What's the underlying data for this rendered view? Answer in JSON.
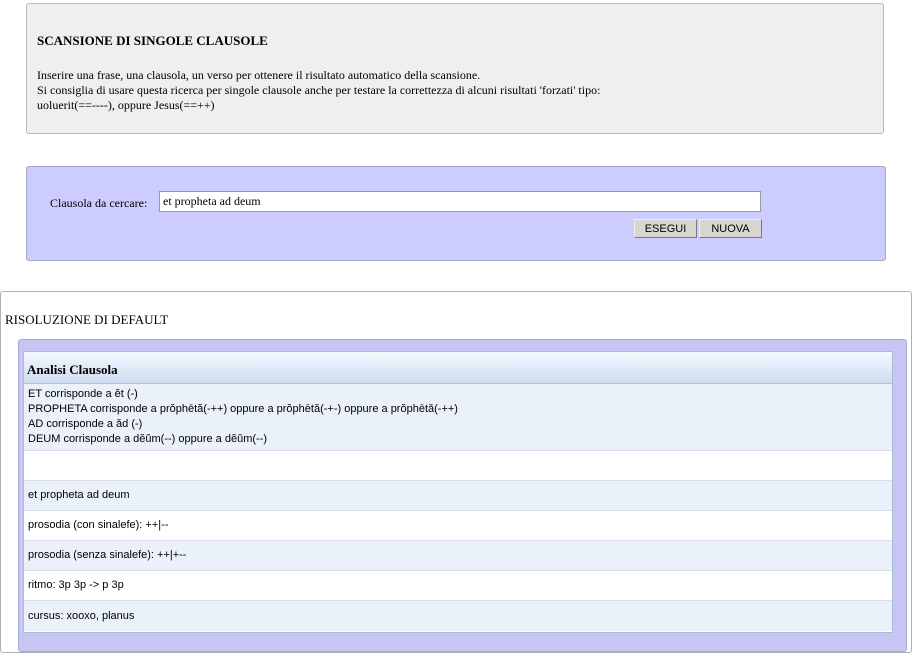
{
  "info": {
    "title": "SCANSIONE DI SINGOLE CLAUSOLE",
    "lines": [
      "Inserire una frase, una clausola, un verso per ottenere il risultato automatico della scansione.",
      "Si consiglia di usare questa ricerca per singole clausole anche per testare la correttezza di alcuni risultati 'forzati' tipo:",
      "uoluerit(==----), oppure Jesus(==++)"
    ]
  },
  "search": {
    "label": "Clausola da cercare:",
    "value": "et propheta ad deum",
    "run_label": "ESEGUI",
    "new_label": "NUOVA"
  },
  "result": {
    "heading": "RISOLUZIONE DI DEFAULT",
    "panel_title": "Analisi Clausola",
    "correspondences": [
      "ET corrisponde a ĕt (-)",
      "PROPHETA corrisponde a prŏphētă(-++) oppure a prŏphētă(-+-) oppure a prŏphētă(-++)",
      "AD corrisponde a ăd (-)",
      "DEUM corrisponde a dĕŭm(--) oppure a dĕŭm(--)"
    ],
    "empty_row": "",
    "phrase": "et propheta ad deum",
    "prosodia_con": "prosodia (con sinalefe): ++|--",
    "prosodia_senza": "prosodia (senza sinalefe): ++|+--",
    "ritmo": "ritmo: 3p 3p -> p 3p",
    "cursus": "cursus: xooxo, planus"
  }
}
